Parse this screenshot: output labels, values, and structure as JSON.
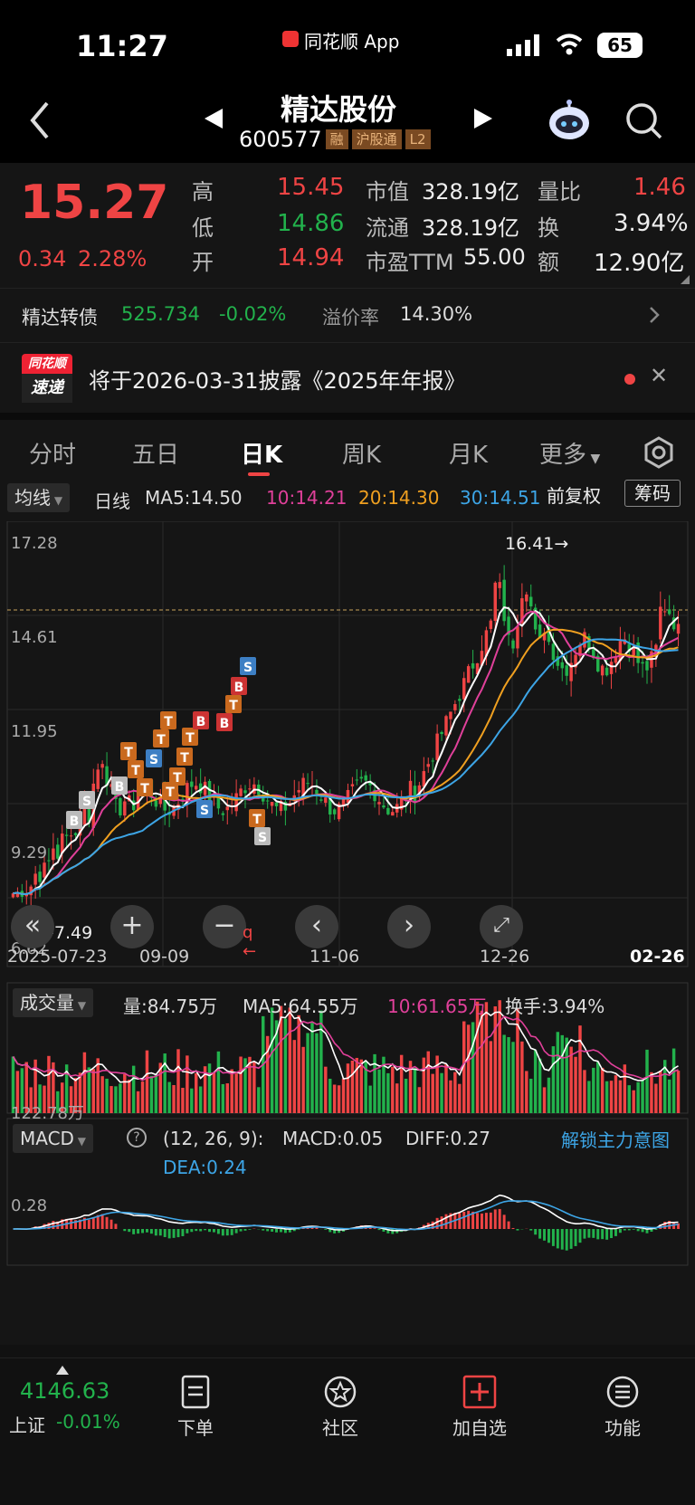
{
  "status": {
    "time": "11:27",
    "app": "同花顺 App",
    "battery": "65"
  },
  "nav": {
    "name": "精达股份",
    "code": "600577",
    "tags": [
      "融",
      "沪股通",
      "L2"
    ]
  },
  "quote": {
    "price": "15.27",
    "change": "0.34",
    "pct": "2.28%",
    "high_l": "高",
    "high": "15.45",
    "low_l": "低",
    "low": "14.86",
    "open_l": "开",
    "open": "14.94",
    "mcap_l": "市值",
    "mcap": "328.19亿",
    "float_l": "流通",
    "float": "328.19亿",
    "pe_l": "市盈TTM",
    "pe": "55.00",
    "vr_l": "量比",
    "vr": "1.46",
    "turn_l": "换",
    "turn": "3.94%",
    "amt_l": "额",
    "amt": "12.90亿"
  },
  "bond": {
    "name": "精达转债",
    "price": "525.734",
    "pct": "-0.02%",
    "prem_l": "溢价率",
    "prem": "14.30%"
  },
  "notice": {
    "logo1": "同花顺",
    "logo2": "速递",
    "text": "将于2026-03-31披露《2025年年报》"
  },
  "tabs": [
    "分时",
    "五日",
    "日K",
    "周K",
    "月K",
    "更多"
  ],
  "kline_head": {
    "ma_btn": "均线",
    "period": "日线",
    "ma5": "MA5:14.50",
    "ma10": "10:14.21",
    "ma20": "20:14.30",
    "ma30": "30:14.51",
    "adj": "前复权",
    "chip": "筹码"
  },
  "kline": {
    "yticks": [
      "17.28",
      "14.61",
      "11.95",
      "9.29",
      "6.62"
    ],
    "max_label": "16.41→",
    "min_label": "←7.49",
    "xticks": [
      "2025-07-23",
      "09-09",
      "11-06",
      "12-26",
      "02-26"
    ]
  },
  "volume": {
    "btn": "成交量",
    "vol": "量:84.75万",
    "ma5": "MA5:64.55万",
    "ma10": "10:61.65万",
    "turn": "换手:3.94%",
    "ytick": "122.78万"
  },
  "macd": {
    "btn": "MACD",
    "params": "(12, 26, 9):",
    "macd": "MACD:0.05",
    "diff": "DIFF:0.27",
    "dea": "DEA:0.24",
    "unlock": "解锁主力意图",
    "ytick": "0.28"
  },
  "bottom": {
    "index_val": "4146.63",
    "index_name": "上证",
    "index_pct": "-0.01%",
    "items": [
      "下单",
      "社区",
      "加自选",
      "功能"
    ]
  },
  "colors": {
    "up": "#ef4444",
    "down": "#22b24c",
    "ma5": "#ffffff",
    "ma10": "#e0409a",
    "ma20": "#f0a020",
    "ma30": "#3da5e6"
  },
  "chart_data": {
    "type": "candlestick",
    "note": "Daily K-line of 600577 from 2025-07-23 to 02-26; y range 6.62–17.28; max 16.41, min 7.49"
  }
}
